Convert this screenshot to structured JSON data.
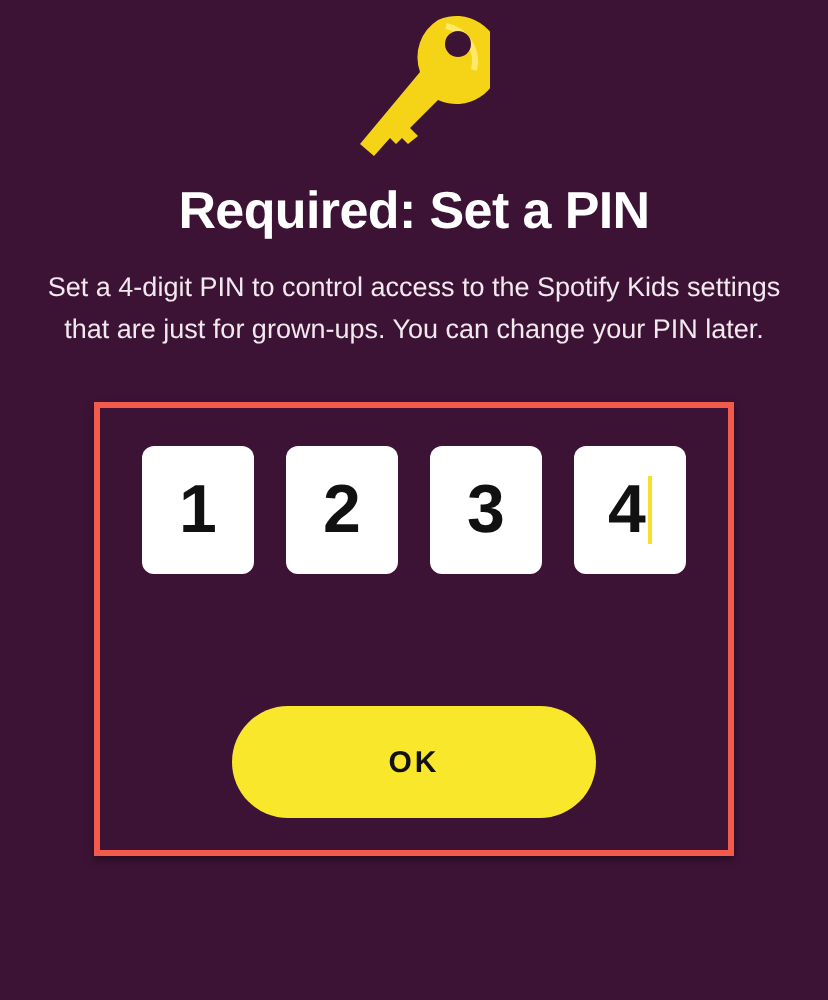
{
  "title": "Required: Set a PIN",
  "description": "Set a 4-digit PIN to control access to the Spotify Kids settings that are just for grown-ups. You can change your PIN later.",
  "pin_section": {
    "highlighted": true,
    "digits": [
      {
        "value": "1",
        "focused": false
      },
      {
        "value": "2",
        "focused": false
      },
      {
        "value": "3",
        "focused": false
      },
      {
        "value": "4",
        "focused": true
      }
    ]
  },
  "ok_button": "OK"
}
